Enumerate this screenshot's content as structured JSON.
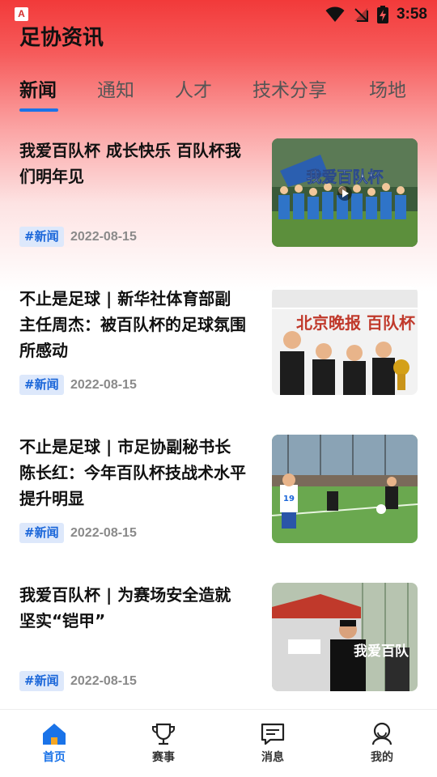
{
  "status_bar": {
    "app_icon_letter": "A",
    "time": "3:58"
  },
  "header": {
    "title": "足协资讯"
  },
  "tabs": [
    {
      "label": "新闻",
      "active": true
    },
    {
      "label": "通知",
      "active": false
    },
    {
      "label": "人才",
      "active": false
    },
    {
      "label": "技术分享",
      "active": false
    },
    {
      "label": "场地",
      "active": false
    }
  ],
  "news": [
    {
      "title": "我爱百队杯 成长快乐 百队杯我们明年见",
      "tag": "#新闻",
      "date": "2022-08-15",
      "thumb_text": "我爱百队杯"
    },
    {
      "title": "不止是足球 | 新华社体育部副主任周杰：被百队杯的足球氛围所感动",
      "tag": "#新闻",
      "date": "2022-08-15",
      "thumb_text": "北京晚报 百队杯"
    },
    {
      "title": "不止是足球 | 市足协副秘书长陈长红：今年百队杯技战术水平提升明显",
      "tag": "#新闻",
      "date": "2022-08-15",
      "thumb_text": "19"
    },
    {
      "title": "我爱百队杯 | 为赛场安全造就坚实“铠甲”",
      "tag": "#新闻",
      "date": "2022-08-15",
      "thumb_text": "我爱百队"
    }
  ],
  "tabbar": [
    {
      "label": "首页",
      "icon": "home-icon",
      "active": true
    },
    {
      "label": "赛事",
      "icon": "trophy-icon",
      "active": false
    },
    {
      "label": "消息",
      "icon": "message-icon",
      "active": false
    },
    {
      "label": "我的",
      "icon": "profile-icon",
      "active": false
    }
  ],
  "colors": {
    "accent": "#1a73e8",
    "header_red": "#f23a3a",
    "tag_bg": "#dde8fb"
  }
}
